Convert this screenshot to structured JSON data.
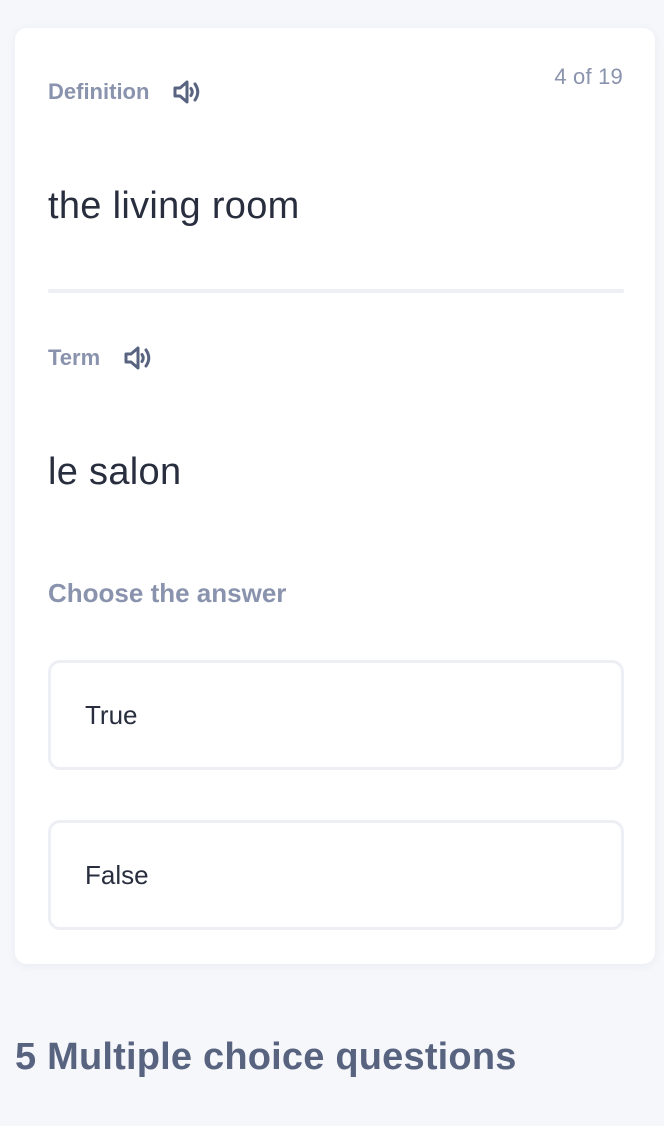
{
  "card": {
    "counter": "4 of 19",
    "definition": {
      "label": "Definition",
      "text": "the living room"
    },
    "term": {
      "label": "Term",
      "text": "le salon"
    },
    "prompt": "Choose the answer",
    "options": [
      {
        "label": "True"
      },
      {
        "label": "False"
      }
    ]
  },
  "section": {
    "title": "5 Multiple choice questions"
  },
  "icons": {
    "audio": "speaker-icon"
  },
  "colors": {
    "background": "#f6f7fb",
    "card": "#ffffff",
    "muted_label": "#8a93ad",
    "text": "#282e3e",
    "heading": "#586380",
    "border": "#edeff4"
  }
}
